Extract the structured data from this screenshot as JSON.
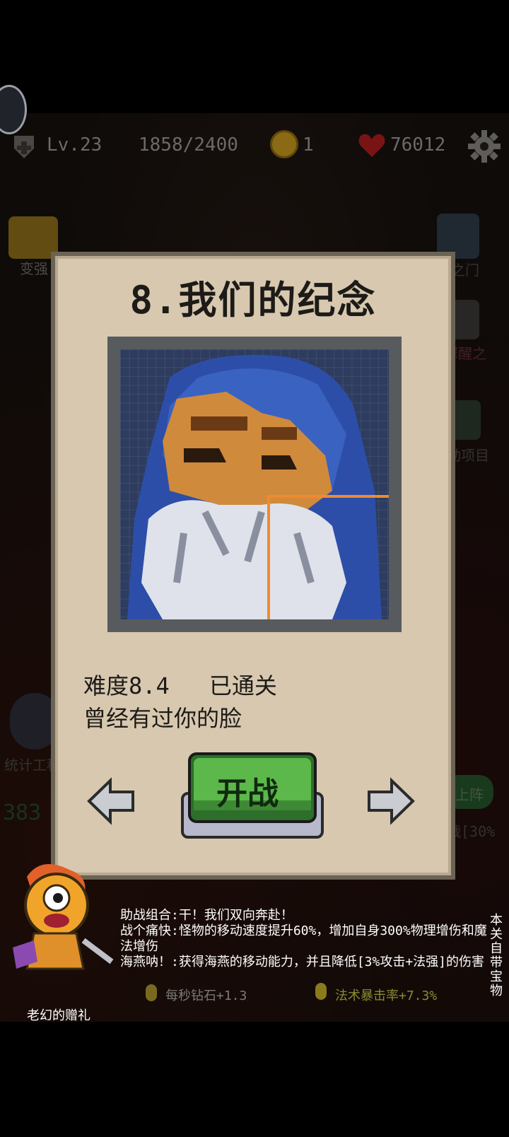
{
  "status": {
    "level": "Lv.23",
    "xp": "1858/2400",
    "coins": "1",
    "hp": "76012"
  },
  "side": {
    "left_top": "变强",
    "left_mid": "统计工程",
    "left_num": "383",
    "right_1": "之门",
    "right_2": "罪醒之",
    "right_3": "动项目",
    "right_4": "上阵",
    "right_5": "战[30%"
  },
  "dialog": {
    "title": "8.我们的纪念",
    "difficulty": "难度8.4",
    "status": "已通关",
    "description": "曾经有过你的脸",
    "start_label": "开战"
  },
  "bottom": {
    "monster_caption": "老幻的赠礼",
    "vertical_label": "本关自带宝物",
    "stat_left": "每秒钻石+1.3",
    "stat_right": "法术暴击率+7.3%",
    "desc_line1": "助战组合:干！我们双向奔赴！",
    "desc_line2": "战个痛快:怪物的移动速度提升60%，增加自身300%物理增伤和魔法增伤",
    "desc_line3": "海燕呐！:获得海燕的移动能力，并且降低[3%攻击+法强]的伤害"
  },
  "colors": {
    "selection": "#f18a2c",
    "panel": "#d7c8af",
    "start_button": "#5cb84a"
  }
}
